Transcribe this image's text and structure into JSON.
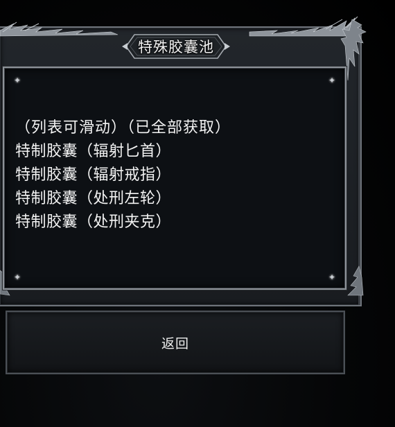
{
  "dialog": {
    "title": "特殊胶囊池"
  },
  "capsule_list": {
    "note": "（列表可滑动）（已全部获取）",
    "items": [
      "特制胶囊（辐射匕首）",
      "特制胶囊（辐射戒指）",
      "特制胶囊（处刑左轮）",
      "特制胶囊（处刑夹克）"
    ]
  },
  "footer": {
    "back_label": "返回"
  },
  "colors": {
    "frame": "#8d9298",
    "panel": "#1c1f23",
    "content_bg": "#0d1014",
    "text": "#f3f3f3"
  },
  "icons": {
    "corner_decoration": "sparkle-star-icon",
    "frame_ornament": "thorn-ornament-icon"
  }
}
